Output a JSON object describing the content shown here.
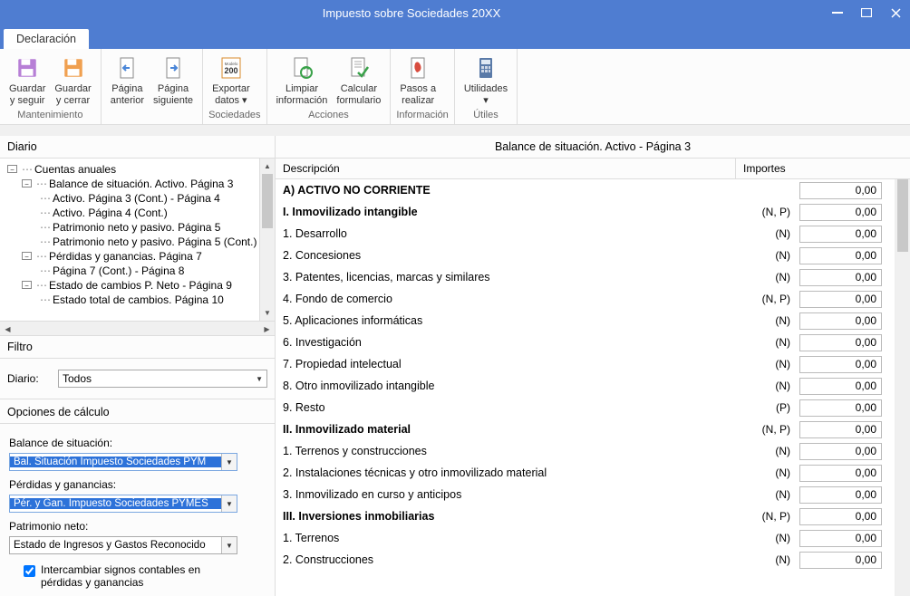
{
  "window": {
    "title": "Impuesto sobre Sociedades 20XX"
  },
  "tabs": {
    "declaracion": "Declaración"
  },
  "ribbon": {
    "group1": {
      "title": "Mantenimiento",
      "btn1_l1": "Guardar",
      "btn1_l2": "y seguir",
      "btn2_l1": "Guardar",
      "btn2_l2": "y cerrar"
    },
    "group2": {
      "btn1_l1": "Página",
      "btn1_l2": "anterior",
      "btn2_l1": "Página",
      "btn2_l2": "siguiente"
    },
    "group3": {
      "title": "Sociedades",
      "btn1_l1": "Exportar",
      "btn1_l2": "datos ▾",
      "iconText": "200"
    },
    "group4": {
      "title": "Acciones",
      "btn1_l1": "Limpiar",
      "btn1_l2": "información",
      "btn2_l1": "Calcular",
      "btn2_l2": "formulario"
    },
    "group5": {
      "title": "Información",
      "btn1_l1": "Pasos a",
      "btn1_l2": "realizar"
    },
    "group6": {
      "title": "Útiles",
      "btn1_l1": "Utilidades",
      "btn1_l2": "▾"
    }
  },
  "left": {
    "diario_header": "Diario",
    "tree": {
      "n0": "Cuentas anuales",
      "n1": "Balance de situación. Activo. Página 3",
      "n1a": "Activo. Página 3 (Cont.) - Página 4",
      "n1b": "Activo. Página 4 (Cont.)",
      "n1c": "Patrimonio neto y pasivo. Página 5",
      "n1d": "Patrimonio neto y pasivo. Página 5 (Cont.)",
      "n2": "Pérdidas y ganancias. Página 7",
      "n2a": "Página 7 (Cont.) - Página 8",
      "n3": "Estado de cambios P. Neto - Página 9",
      "n3a": "Estado total de cambios. Página 10"
    },
    "filtro_header": "Filtro",
    "filtro_diario_label": "Diario:",
    "filtro_diario_value": "Todos",
    "opts_header": "Opciones de cálculo",
    "balance_label": "Balance de situación:",
    "balance_value": "Bal. Situación  Impuesto Sociedades PYM",
    "pyg_label": "Pérdidas y ganancias:",
    "pyg_value": "Pér. y Gan.  Impuesto Sociedades PYMES",
    "pn_label": "Patrimonio neto:",
    "pn_value": "Estado de Ingresos y Gastos Reconocido",
    "check_label": "Intercambiar signos contables en pérdidas y ganancias"
  },
  "right": {
    "title": "Balance de situación. Activo - Página 3",
    "col_desc": "Descripción",
    "col_imp": "Importes",
    "rows": [
      {
        "d": "A) ACTIVO NO CORRIENTE",
        "t": "",
        "b": 1,
        "v": "0,00"
      },
      {
        "d": "I. Inmovilizado intangible",
        "t": "(N, P)",
        "b": 1,
        "v": "0,00"
      },
      {
        "d": "1. Desarrollo",
        "t": "(N)",
        "b": 0,
        "v": "0,00"
      },
      {
        "d": "2. Concesiones",
        "t": "(N)",
        "b": 0,
        "v": "0,00"
      },
      {
        "d": "3. Patentes, licencias, marcas y similares",
        "t": "(N)",
        "b": 0,
        "v": "0,00"
      },
      {
        "d": "4. Fondo de comercio",
        "t": "(N, P)",
        "b": 0,
        "v": "0,00"
      },
      {
        "d": "5. Aplicaciones informáticas",
        "t": "(N)",
        "b": 0,
        "v": "0,00"
      },
      {
        "d": "6. Investigación",
        "t": "(N)",
        "b": 0,
        "v": "0,00"
      },
      {
        "d": "7. Propiedad intelectual",
        "t": "(N)",
        "b": 0,
        "v": "0,00"
      },
      {
        "d": "8. Otro inmovilizado intangible",
        "t": "(N)",
        "b": 0,
        "v": "0,00"
      },
      {
        "d": "9. Resto",
        "t": "(P)",
        "b": 0,
        "v": "0,00"
      },
      {
        "d": "II. Inmovilizado material",
        "t": "(N, P)",
        "b": 1,
        "v": "0,00"
      },
      {
        "d": "1. Terrenos y construcciones",
        "t": "(N)",
        "b": 0,
        "v": "0,00"
      },
      {
        "d": "2. Instalaciones técnicas y otro inmovilizado material",
        "t": "(N)",
        "b": 0,
        "v": "0,00"
      },
      {
        "d": "3. Inmovilizado en curso y anticipos",
        "t": "(N)",
        "b": 0,
        "v": "0,00"
      },
      {
        "d": "III. Inversiones inmobiliarias",
        "t": "(N, P)",
        "b": 1,
        "v": "0,00"
      },
      {
        "d": "1. Terrenos",
        "t": "(N)",
        "b": 0,
        "v": "0,00"
      },
      {
        "d": "2. Construcciones",
        "t": "(N)",
        "b": 0,
        "v": "0,00"
      }
    ]
  }
}
